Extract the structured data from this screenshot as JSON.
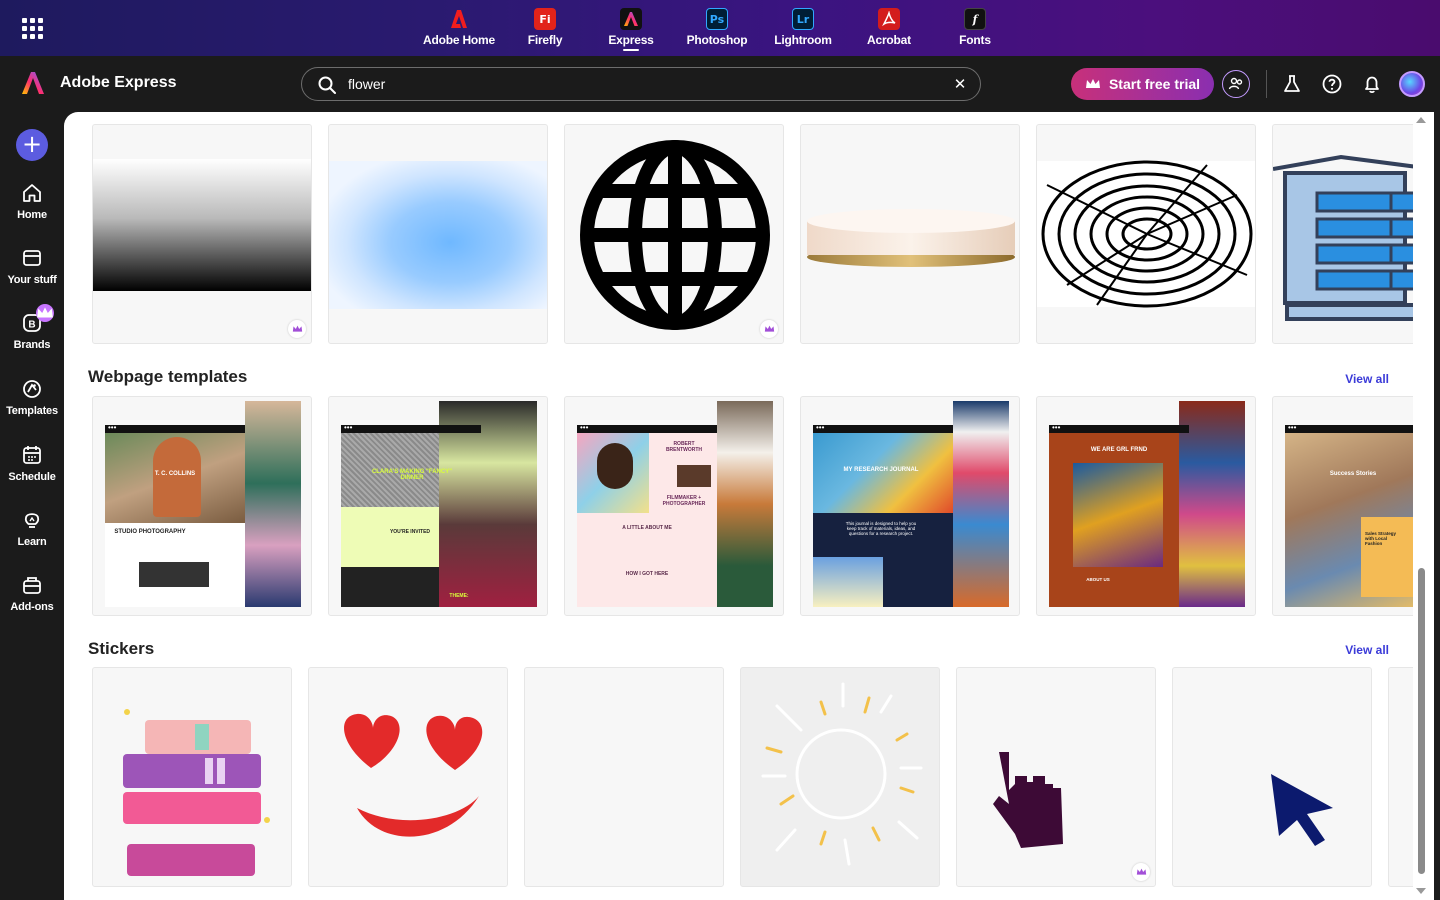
{
  "appbar": {
    "apps": [
      {
        "name": "Adobe Home",
        "icon": "A",
        "color": "#e01f1f"
      },
      {
        "name": "Firefly",
        "icon": "Fi",
        "color": "#e2231a"
      },
      {
        "name": "Express",
        "icon": "A",
        "color": "#1b1b1b",
        "active": true
      },
      {
        "name": "Photoshop",
        "icon": "Ps",
        "color": "#0b2a4e"
      },
      {
        "name": "Lightroom",
        "icon": "Lr",
        "color": "#0b2a4e"
      },
      {
        "name": "Acrobat",
        "icon": "A",
        "color": "#d31c1c"
      },
      {
        "name": "Fonts",
        "icon": "f",
        "color": "#1b1b1b"
      }
    ]
  },
  "header": {
    "brand": "Adobe Express",
    "search_value": "flower",
    "trial_label": "Start free trial"
  },
  "rail": {
    "create_label": "+",
    "items": [
      {
        "label": "Home",
        "icon": "home-icon"
      },
      {
        "label": "Your stuff",
        "icon": "folder-icon"
      },
      {
        "label": "Brands",
        "icon": "brand-icon"
      },
      {
        "label": "Templates",
        "icon": "templates-icon"
      },
      {
        "label": "Schedule",
        "icon": "calendar-icon"
      },
      {
        "label": "Learn",
        "icon": "lightbulb-icon"
      },
      {
        "label": "Add-ons",
        "icon": "addons-icon"
      }
    ]
  },
  "sections": {
    "webpage": {
      "title": "Webpage templates",
      "view_all": "View all"
    },
    "stickers": {
      "title": "Stickers",
      "view_all": "View all"
    }
  },
  "templates": [
    {
      "headline": "T. C. COLLINS",
      "sub": "STUDIO PHOTOGRAPHY"
    },
    {
      "headline": "CLARA'S MAKING \"FANCY\" DINNER",
      "sub": "YOU'RE INVITED",
      "extra": "THEME:"
    },
    {
      "headline": "ROBERT BRENTWORTH",
      "sub": "FILMMAKER + PHOTOGRAPHER",
      "extra": "A LITTLE ABOUT ME",
      "extra2": "HOW I GOT HERE"
    },
    {
      "headline": "MY RESEARCH JOURNAL",
      "sub": "This journal is designed to help you keep track of materials, ideas, and questions for a research project."
    },
    {
      "headline": "WE ARE GRL FRND",
      "sub": "ABOUT US"
    },
    {
      "headline": "Success Stories",
      "sub": "Sales Strategy with Local Fashion"
    }
  ],
  "colors": {
    "accent": "#5c5ce0",
    "link": "#3b3bd8",
    "trial_start": "#c8307a",
    "trial_end": "#8a2fb0"
  }
}
